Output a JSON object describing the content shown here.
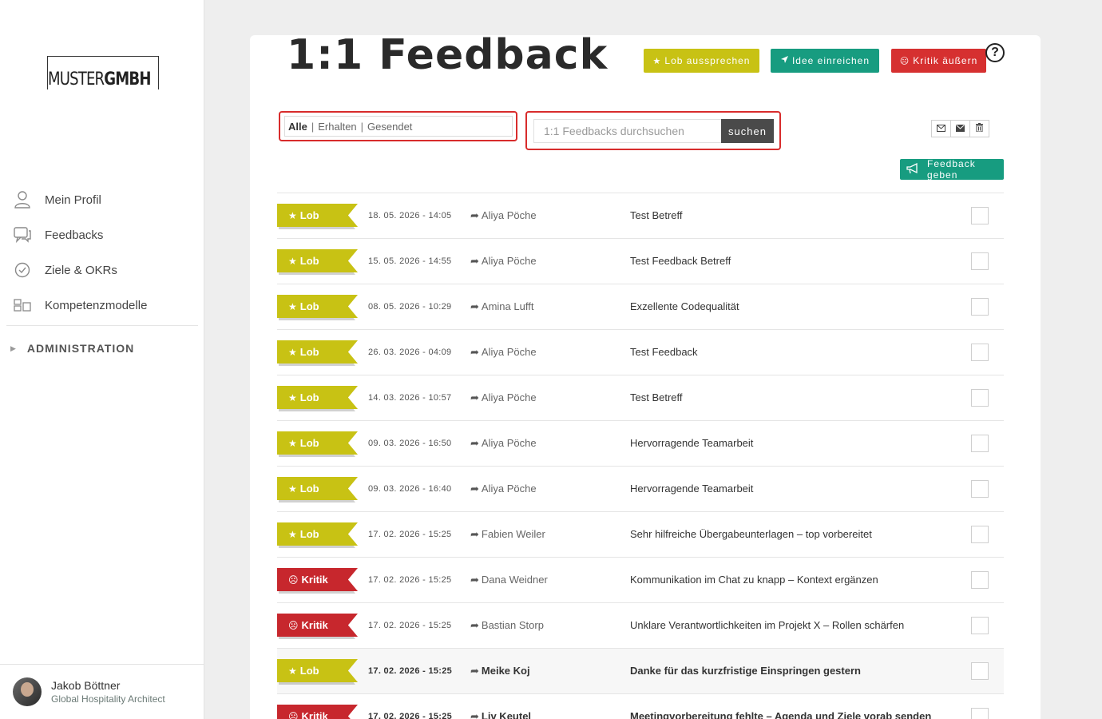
{
  "brand": {
    "logo_prefix": "MUSTER",
    "logo_suffix": "GMBH"
  },
  "sidebar": {
    "items": [
      {
        "label": "Mein Profil",
        "icon": "user-icon"
      },
      {
        "label": "Feedbacks",
        "icon": "chat-bubbles-icon"
      },
      {
        "label": "Ziele & OKRs",
        "icon": "check-circle-icon"
      },
      {
        "label": "Kompetenzmodelle",
        "icon": "competence-icon"
      }
    ],
    "admin_label": "ADMINISTRATION"
  },
  "user": {
    "name": "Jakob Böttner",
    "role": "Global Hospitality Architect"
  },
  "page": {
    "title": "1:1 Feedback"
  },
  "actions": {
    "lob": "Lob aussprechen",
    "idee": "Idee einreichen",
    "kritik": "Kritik äußern",
    "help": "?",
    "feedback_geben": "Feedback geben"
  },
  "filter": {
    "all": "Alle",
    "received": "Erhalten",
    "sent": "Gesendet",
    "separator": "|"
  },
  "search": {
    "placeholder": "1:1 Feedbacks durchsuchen",
    "button": "suchen"
  },
  "colors": {
    "lob": "#c8c214",
    "idee": "#179c80",
    "kritik": "#d63030",
    "highlight_border": "#d82c2c"
  },
  "feedbacks": [
    {
      "type": "Lob",
      "date": "18. 05. 2026 - 14:05",
      "sender": "Aliya Pöche",
      "subject": "Test Betreff"
    },
    {
      "type": "Lob",
      "date": "15. 05. 2026 - 14:55",
      "sender": "Aliya Pöche",
      "subject": "Test Feedback Betreff"
    },
    {
      "type": "Lob",
      "date": "08. 05. 2026 - 10:29",
      "sender": "Amina Lufft",
      "subject": "Exzellente Codequalität"
    },
    {
      "type": "Lob",
      "date": "26. 03. 2026 - 04:09",
      "sender": "Aliya Pöche",
      "subject": "Test Feedback"
    },
    {
      "type": "Lob",
      "date": "14. 03. 2026 - 10:57",
      "sender": "Aliya Pöche",
      "subject": "Test Betreff"
    },
    {
      "type": "Lob",
      "date": "09. 03. 2026 - 16:50",
      "sender": "Aliya Pöche",
      "subject": "Hervorragende Teamarbeit"
    },
    {
      "type": "Lob",
      "date": "09. 03. 2026 - 16:40",
      "sender": "Aliya Pöche",
      "subject": "Hervorragende Teamarbeit"
    },
    {
      "type": "Lob",
      "date": "17. 02. 2026 - 15:25",
      "sender": "Fabien Weiler",
      "subject": "Sehr hilfreiche Übergabeunterlagen – top vorbereitet"
    },
    {
      "type": "Kritik",
      "date": "17. 02. 2026 - 15:25",
      "sender": "Dana Weidner",
      "subject": "Kommunikation im Chat zu knapp – Kontext ergänzen"
    },
    {
      "type": "Kritik",
      "date": "17. 02. 2026 - 15:25",
      "sender": "Bastian Storp",
      "subject": "Unklare Verantwortlichkeiten im Projekt X – Rollen schärfen"
    },
    {
      "type": "Lob",
      "date": "17. 02. 2026 - 15:25",
      "sender": "Meike Koj",
      "subject": "Danke für das kurzfristige Einspringen gestern",
      "unread": true
    },
    {
      "type": "Kritik",
      "date": "17. 02. 2026 - 15:25",
      "sender": "Liv Keutel",
      "subject": "Meetingvorbereitung fehlte – Agenda und Ziele vorab senden",
      "unread": true
    }
  ]
}
